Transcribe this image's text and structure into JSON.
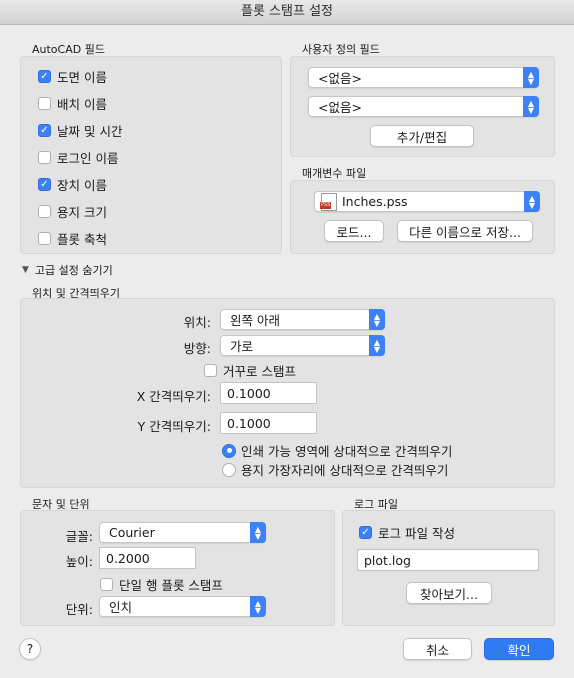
{
  "window": {
    "title": "플롯 스탬프 설정"
  },
  "autocad_fields": {
    "label": "AutoCAD 필드",
    "items": [
      {
        "label": "도면 이름",
        "checked": true
      },
      {
        "label": "배치 이름",
        "checked": false
      },
      {
        "label": "날짜 및 시간",
        "checked": true
      },
      {
        "label": "로그인 이름",
        "checked": false
      },
      {
        "label": "장치 이름",
        "checked": true
      },
      {
        "label": "용지 크기",
        "checked": false
      },
      {
        "label": "플롯 축척",
        "checked": false
      }
    ]
  },
  "user_fields": {
    "label": "사용자 정의 필드",
    "select1": "<없음>",
    "select2": "<없음>",
    "add_edit": "추가/편집"
  },
  "param_file": {
    "label": "매개변수 파일",
    "file": "Inches.pss",
    "file_icon_text": "PSS",
    "load": "로드...",
    "save_as": "다른 이름으로 저장..."
  },
  "advanced_toggle": "고급 설정 숨기기",
  "location": {
    "label": "위치 및 간격띄우기",
    "position_label": "위치:",
    "position_value": "왼쪽 아래",
    "orientation_label": "방향:",
    "orientation_value": "가로",
    "upside_down": "거꾸로 스탬프",
    "x_label": "X 간격띄우기:",
    "x_value": "0.1000",
    "y_label": "Y 간격띄우기:",
    "y_value": "0.1000",
    "radio1": "인쇄 가능 영역에 상대적으로 간격띄우기",
    "radio2": "용지 가장자리에 상대적으로 간격띄우기"
  },
  "text_units": {
    "label": "문자 및 단위",
    "font_label": "글꼴:",
    "font_value": "Courier",
    "height_label": "높이:",
    "height_value": "0.2000",
    "single_line": "단일 행 플롯 스탬프",
    "units_label": "단위:",
    "units_value": "인치"
  },
  "log_file": {
    "label": "로그 파일",
    "create": "로그 파일 작성",
    "filename": "plot.log",
    "browse": "찾아보기..."
  },
  "footer": {
    "help": "?",
    "cancel": "취소",
    "ok": "확인"
  },
  "colors": {
    "accent": "#3c82f6",
    "primary_button": "#2f7bf5",
    "pss_icon": "#c0392b"
  }
}
